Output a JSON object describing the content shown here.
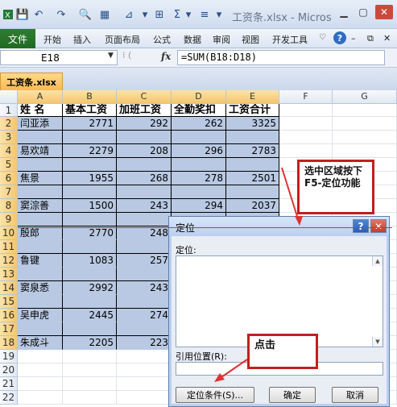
{
  "window": {
    "title": "工资条.xlsx - Micros",
    "quick_access_icons": [
      "save-icon",
      "undo-icon",
      "redo-icon",
      "print-preview-icon",
      "format-icon",
      "filter-icon",
      "border-icon",
      "sum-icon",
      "align-icon"
    ]
  },
  "ribbon": {
    "file": "文件",
    "tabs": [
      "开始",
      "插入",
      "页面布局",
      "公式",
      "数据",
      "审阅",
      "视图",
      "开发工具"
    ]
  },
  "formula_bar": {
    "name_box": "E18",
    "fx": "fx",
    "formula": "=SUM(B18:D18)"
  },
  "sheet_tab": "工资条.xlsx",
  "columns": [
    "A",
    "B",
    "C",
    "D",
    "E",
    "F",
    "G"
  ],
  "rows": [
    "1",
    "2",
    "3",
    "4",
    "5",
    "6",
    "7",
    "8",
    "9",
    "10",
    "11",
    "12",
    "13",
    "14",
    "15",
    "16",
    "17",
    "18",
    "19",
    "20",
    "21",
    "22"
  ],
  "table": {
    "headers": [
      "姓 名",
      "基本工资",
      "加班工资",
      "全勤奖扣",
      "工资合计"
    ],
    "data": [
      {
        "row": "2",
        "name": "闫亚添",
        "base": "2771",
        "ot": "292",
        "bonus": "262",
        "total": "3325"
      },
      {
        "row": "4",
        "name": "易欢靖",
        "base": "2279",
        "ot": "208",
        "bonus": "296",
        "total": "2783"
      },
      {
        "row": "6",
        "name": "焦景",
        "base": "1955",
        "ot": "268",
        "bonus": "278",
        "total": "2501"
      },
      {
        "row": "8",
        "name": "窦淙善",
        "base": "1500",
        "ot": "243",
        "bonus": "294",
        "total": "2037"
      },
      {
        "row": "10",
        "name": "殷郎",
        "base": "2770",
        "ot": "248",
        "bonus": "",
        "total": ""
      },
      {
        "row": "12",
        "name": "鲁键",
        "base": "1083",
        "ot": "257",
        "bonus": "",
        "total": ""
      },
      {
        "row": "14",
        "name": "窦泉悉",
        "base": "2992",
        "ot": "243",
        "bonus": "",
        "total": ""
      },
      {
        "row": "16",
        "name": "吴申虎",
        "base": "2445",
        "ot": "274",
        "bonus": "",
        "total": ""
      },
      {
        "row": "18",
        "name": "朱成斗",
        "base": "2205",
        "ot": "223",
        "bonus": "",
        "total": ""
      }
    ]
  },
  "dialog": {
    "title": "定位",
    "goto_label": "定位:",
    "reference_label": "引用位置(R):",
    "special_button": "定位条件(S)...",
    "ok_button": "确定",
    "cancel_button": "取消"
  },
  "callouts": {
    "first": "选中区域按下F5-定位功能",
    "second": "点击"
  }
}
